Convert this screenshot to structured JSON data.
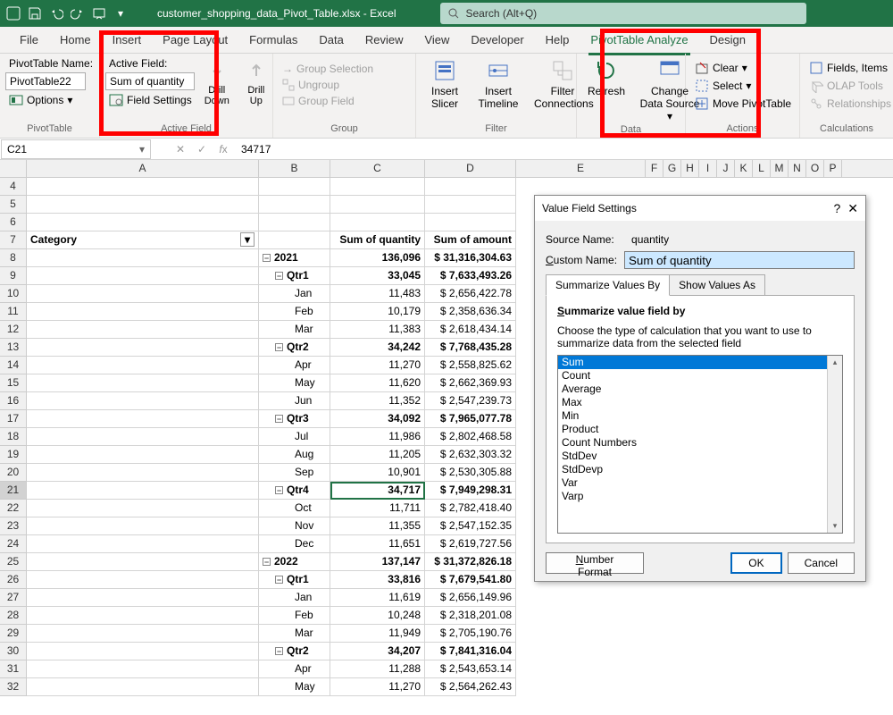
{
  "titlebar": {
    "filename": "customer_shopping_data_Pivot_Table.xlsx  -  Excel",
    "search_placeholder": "Search (Alt+Q)"
  },
  "tabs": [
    "File",
    "Home",
    "Insert",
    "Page Layout",
    "Formulas",
    "Data",
    "Review",
    "View",
    "Developer",
    "Help",
    "PivotTable Analyze",
    "Design"
  ],
  "active_tab_index": 10,
  "ribbon": {
    "pt_group": {
      "label": "PivotTable",
      "name_lbl": "PivotTable Name:",
      "name_val": "PivotTable22",
      "options": "Options"
    },
    "af_group": {
      "label": "Active Field",
      "active_field_lbl": "Active Field:",
      "active_field_val": "Sum of quantity",
      "field_settings": "Field Settings",
      "drill_down": "Drill Down",
      "drill_up": "Drill Up"
    },
    "group_group": {
      "label": "Group",
      "sel": "Group Selection",
      "ung": "Ungroup",
      "fld": "Group Field"
    },
    "filter_group": {
      "label": "Filter",
      "slicer": "Insert Slicer",
      "timeline": "Insert Timeline",
      "conn": "Filter Connections"
    },
    "data_group": {
      "label": "Data",
      "refresh": "Refresh",
      "change": "Change Data Source"
    },
    "actions_group": {
      "label": "Actions",
      "clear": "Clear",
      "select": "Select",
      "move": "Move PivotTable"
    },
    "calc_group": {
      "label": "Calculations",
      "fields": "Fields, Items",
      "olap": "OLAP Tools",
      "rel": "Relationships"
    }
  },
  "formula_bar": {
    "name": "C21",
    "value": "34717"
  },
  "columns": [
    "A",
    "B",
    "C",
    "D",
    "E",
    "F",
    "G",
    "H",
    "I",
    "J",
    "K",
    "L",
    "M",
    "N",
    "O",
    "P"
  ],
  "pivot_headers": {
    "cat": "Category",
    "qty": "Sum of quantity",
    "amt": "Sum of amount"
  },
  "rows": [
    {
      "rn": 4
    },
    {
      "rn": 5
    },
    {
      "rn": 6
    },
    {
      "rn": 7,
      "header": true
    },
    {
      "rn": 8,
      "lvl": 0,
      "lbl": "2021",
      "qty": "136,096",
      "amt": "$  31,316,304.63",
      "bold": true
    },
    {
      "rn": 9,
      "lvl": 1,
      "lbl": "Qtr1",
      "qty": "33,045",
      "amt": "$   7,633,493.26",
      "bold": true
    },
    {
      "rn": 10,
      "lvl": 2,
      "lbl": "Jan",
      "qty": "11,483",
      "amt": "$   2,656,422.78"
    },
    {
      "rn": 11,
      "lvl": 2,
      "lbl": "Feb",
      "qty": "10,179",
      "amt": "$   2,358,636.34"
    },
    {
      "rn": 12,
      "lvl": 2,
      "lbl": "Mar",
      "qty": "11,383",
      "amt": "$   2,618,434.14"
    },
    {
      "rn": 13,
      "lvl": 1,
      "lbl": "Qtr2",
      "qty": "34,242",
      "amt": "$   7,768,435.28",
      "bold": true
    },
    {
      "rn": 14,
      "lvl": 2,
      "lbl": "Apr",
      "qty": "11,270",
      "amt": "$   2,558,825.62"
    },
    {
      "rn": 15,
      "lvl": 2,
      "lbl": "May",
      "qty": "11,620",
      "amt": "$   2,662,369.93"
    },
    {
      "rn": 16,
      "lvl": 2,
      "lbl": "Jun",
      "qty": "11,352",
      "amt": "$   2,547,239.73"
    },
    {
      "rn": 17,
      "lvl": 1,
      "lbl": "Qtr3",
      "qty": "34,092",
      "amt": "$   7,965,077.78",
      "bold": true
    },
    {
      "rn": 18,
      "lvl": 2,
      "lbl": "Jul",
      "qty": "11,986",
      "amt": "$   2,802,468.58"
    },
    {
      "rn": 19,
      "lvl": 2,
      "lbl": "Aug",
      "qty": "11,205",
      "amt": "$   2,632,303.32"
    },
    {
      "rn": 20,
      "lvl": 2,
      "lbl": "Sep",
      "qty": "10,901",
      "amt": "$   2,530,305.88"
    },
    {
      "rn": 21,
      "lvl": 1,
      "lbl": "Qtr4",
      "qty": "34,717",
      "amt": "$   7,949,298.31",
      "bold": true,
      "active": true
    },
    {
      "rn": 22,
      "lvl": 2,
      "lbl": "Oct",
      "qty": "11,711",
      "amt": "$   2,782,418.40"
    },
    {
      "rn": 23,
      "lvl": 2,
      "lbl": "Nov",
      "qty": "11,355",
      "amt": "$   2,547,152.35"
    },
    {
      "rn": 24,
      "lvl": 2,
      "lbl": "Dec",
      "qty": "11,651",
      "amt": "$   2,619,727.56"
    },
    {
      "rn": 25,
      "lvl": 0,
      "lbl": "2022",
      "qty": "137,147",
      "amt": "$  31,372,826.18",
      "bold": true
    },
    {
      "rn": 26,
      "lvl": 1,
      "lbl": "Qtr1",
      "qty": "33,816",
      "amt": "$   7,679,541.80",
      "bold": true
    },
    {
      "rn": 27,
      "lvl": 2,
      "lbl": "Jan",
      "qty": "11,619",
      "amt": "$   2,656,149.96"
    },
    {
      "rn": 28,
      "lvl": 2,
      "lbl": "Feb",
      "qty": "10,248",
      "amt": "$   2,318,201.08"
    },
    {
      "rn": 29,
      "lvl": 2,
      "lbl": "Mar",
      "qty": "11,949",
      "amt": "$   2,705,190.76"
    },
    {
      "rn": 30,
      "lvl": 1,
      "lbl": "Qtr2",
      "qty": "34,207",
      "amt": "$   7,841,316.04",
      "bold": true
    },
    {
      "rn": 31,
      "lvl": 2,
      "lbl": "Apr",
      "qty": "11,288",
      "amt": "$   2,543,653.14"
    },
    {
      "rn": 32,
      "lvl": 2,
      "lbl": "May",
      "qty": "11,270",
      "amt": "$   2,564,262.43"
    }
  ],
  "dialog": {
    "title": "Value Field Settings",
    "src_lbl": "Source Name:",
    "src_val": "quantity",
    "name_lbl": "Custom Name:",
    "name_val": "Sum of quantity",
    "tab1": "Summarize Values By",
    "tab2": "Show Values As",
    "frame_title": "Summarize value field by",
    "frame_desc": "Choose the type of calculation that you want to use to summarize data from the selected field",
    "list": [
      "Sum",
      "Count",
      "Average",
      "Max",
      "Min",
      "Product",
      "Count Numbers",
      "StdDev",
      "StdDevp",
      "Var",
      "Varp"
    ],
    "selected": 0,
    "nf": "Number Format",
    "ok": "OK",
    "cancel": "Cancel"
  }
}
